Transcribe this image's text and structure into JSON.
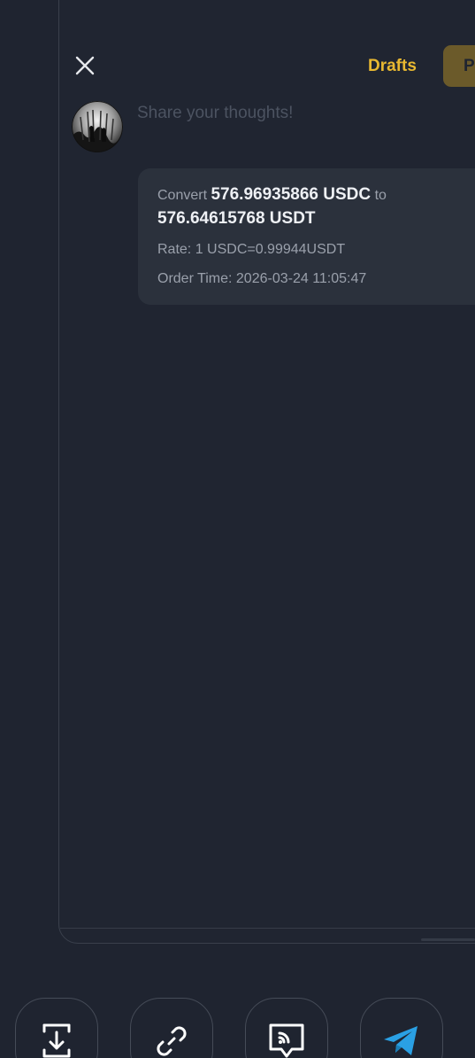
{
  "header": {
    "close_icon": "close-icon",
    "drafts_label": "Drafts",
    "post_label": "P"
  },
  "composer": {
    "placeholder": "Share your thoughts!"
  },
  "order_card": {
    "convert_word": "Convert",
    "from_amount": "576.96935866 USDC",
    "to_word": "to",
    "to_amount": "576.64615768 USDT",
    "rate": "Rate: 1 USDC=0.99944USDT",
    "order_time": "Order Time: 2026-03-24 11:05:47"
  },
  "share_bar": {
    "icons": [
      "download-icon",
      "link-icon",
      "feed-chat-icon",
      "telegram-icon"
    ]
  },
  "colors": {
    "background": "#1f2430",
    "accent": "#e8b831",
    "card": "#2b313c",
    "telegram": "#2aa0e4"
  }
}
